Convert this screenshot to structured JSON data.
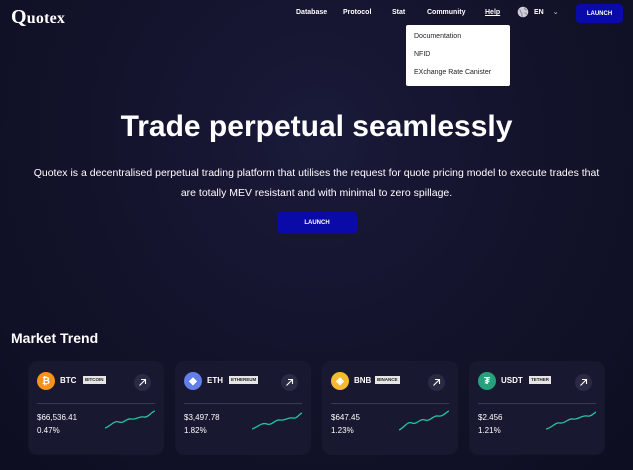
{
  "brand": {
    "first": "Q",
    "rest": "uotex"
  },
  "nav": {
    "items": [
      "Database",
      "Protocol",
      "Stat",
      "Community",
      "Help"
    ],
    "language": "EN",
    "launch_label": "LAUNCH"
  },
  "help_menu": {
    "items": [
      "Documentation",
      "NFID",
      "EXchange Rate Canister"
    ]
  },
  "hero": {
    "title": "Trade perpetual seamlessly",
    "subtitle_line1": "Quotex is a decentralised perpetual trading platform that utilises the request for quote pricing model to execute trades that",
    "subtitle_line2": "are totally MEV resistant and with minimal to zero spillage.",
    "launch_label": "LAUNCH"
  },
  "market": {
    "title": "Market Trend",
    "cards": [
      {
        "symbol": "BTC",
        "name": "BITCOIN",
        "price": "$66,536.41",
        "change": "0.47%",
        "icon": "bitcoin-icon",
        "color": "#f7931a",
        "glyph": "₿"
      },
      {
        "symbol": "ETH",
        "name": "ETHEREUM",
        "price": "$3,497.78",
        "change": "1.82%",
        "icon": "ethereum-icon",
        "color": "#627eea",
        "glyph": "◆"
      },
      {
        "symbol": "BNB",
        "name": "BINANCE",
        "price": "$647.45",
        "change": "1.23%",
        "icon": "binance-icon",
        "color": "#f3ba2f",
        "glyph": "◈"
      },
      {
        "symbol": "USDT",
        "name": "TETHER",
        "price": "$2.456",
        "change": "1.21%",
        "icon": "tether-icon",
        "color": "#26a17b",
        "glyph": "₮"
      }
    ]
  },
  "colors": {
    "accent": "#0a0aa8",
    "sparkline": "#27c4a0",
    "background": "#12122a"
  }
}
